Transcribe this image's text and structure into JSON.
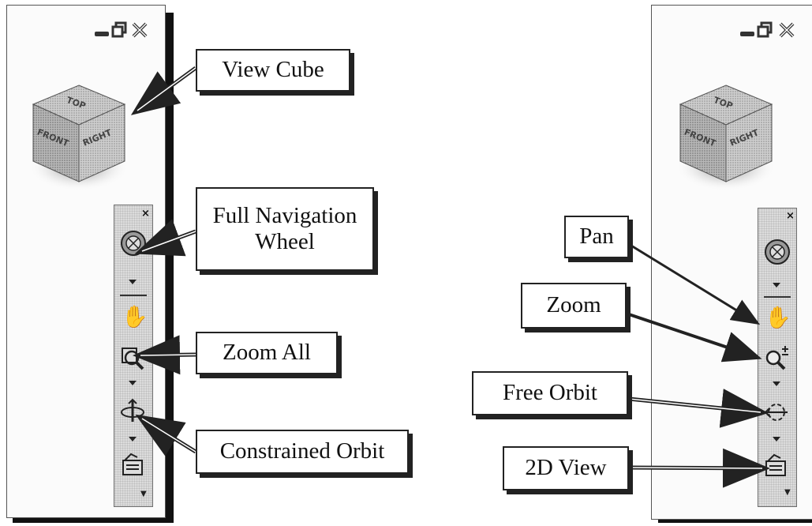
{
  "callouts_left": {
    "view_cube": "View Cube",
    "full_navigation_wheel_line1": "Full Navigation",
    "full_navigation_wheel_line2": "Wheel",
    "zoom_all": "Zoom All",
    "constrained_orbit": "Constrained Orbit"
  },
  "callouts_right": {
    "pan": "Pan",
    "zoom": "Zoom",
    "free_orbit": "Free Orbit",
    "view_2d": "2D View"
  },
  "view_cube_faces": {
    "top": "TOP",
    "front": "FRONT",
    "right": "RIGHT"
  },
  "window_controls": [
    "minimize-icon",
    "restore-icon",
    "close-icon"
  ],
  "navbar_close": "×",
  "navbar_tools_left": [
    "full-navigation-wheel-icon",
    "pan-icon",
    "zoom-all-icon",
    "constrained-orbit-icon",
    "2d-view-icon"
  ],
  "navbar_tools_right": [
    "full-navigation-wheel-icon",
    "pan-icon",
    "zoom-icon",
    "free-orbit-icon",
    "2d-view-icon"
  ]
}
